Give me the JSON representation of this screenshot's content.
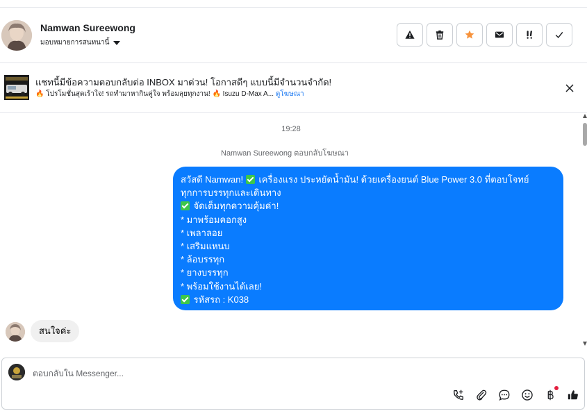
{
  "header": {
    "contact_name": "Namwan Sureewong",
    "assign_label": "มอบหมายการสนทนานี้",
    "actions": [
      {
        "icon": "warning-icon",
        "label": "report spam"
      },
      {
        "icon": "trash-icon",
        "label": "delete"
      },
      {
        "icon": "star-icon",
        "label": "star"
      },
      {
        "icon": "envelope-icon",
        "label": "mark as unread"
      },
      {
        "icon": "follow-up-icon",
        "label": "follow up"
      },
      {
        "icon": "check-icon",
        "label": "mark as done"
      }
    ]
  },
  "banner": {
    "title": "แชทนี้มีข้อความตอบกลับต่อ INBOX มาด่วน! โอกาสดีๆ แบบนี้มีจำนวนจำกัด!",
    "subtitle": "🔥 โปรโมชั่นสุดเร้าใจ! รถทำมาหากินคู่ใจ พร้อมลุยทุกงาน! 🔥 Isuzu D-Max A...",
    "link": "ดูโฆษณา"
  },
  "chat": {
    "timestamp": "19:28",
    "reply_note": "Namwan Sureewong ตอบกลับโฆษณา",
    "outgoing_lines": [
      {
        "check": false,
        "text": "สวัสดี Namwan! "
      },
      {
        "check": false,
        "text": "ทุกการบรรทุกและเดินทาง"
      },
      {
        "check": true,
        "text": " จัดเต็มทุกความคุ้มค่า!"
      },
      {
        "check": false,
        "text": "* มาพร้อมคอกสูง"
      },
      {
        "check": false,
        "text": "* เพลาลอย"
      },
      {
        "check": false,
        "text": "* เสริมแหนบ"
      },
      {
        "check": false,
        "text": "* ล้อบรรทุก"
      },
      {
        "check": false,
        "text": "* ยางบรรทุก"
      },
      {
        "check": false,
        "text": "* พร้อมใช้งานได้เลย!"
      },
      {
        "check": true,
        "text": " รหัสรถ : K038"
      }
    ],
    "first_line_tail": " เครื่องแรง ประหยัดน้ำมัน! ด้วยเครื่องยนต์ Blue Power 3.0 ที่ตอบโจทย์",
    "incoming_message": "สนใจค่ะ"
  },
  "composer": {
    "placeholder": "ตอบกลับใน Messenger...",
    "tools": [
      "phone-add-icon",
      "paperclip-icon",
      "chat-bubble-icon",
      "emoji-icon",
      "baht-icon",
      "thumbs-up-icon"
    ]
  },
  "colors": {
    "accent": "#0a7cff",
    "link": "#1877f2",
    "star": "#f7923b",
    "border": "#ccd0d5"
  }
}
